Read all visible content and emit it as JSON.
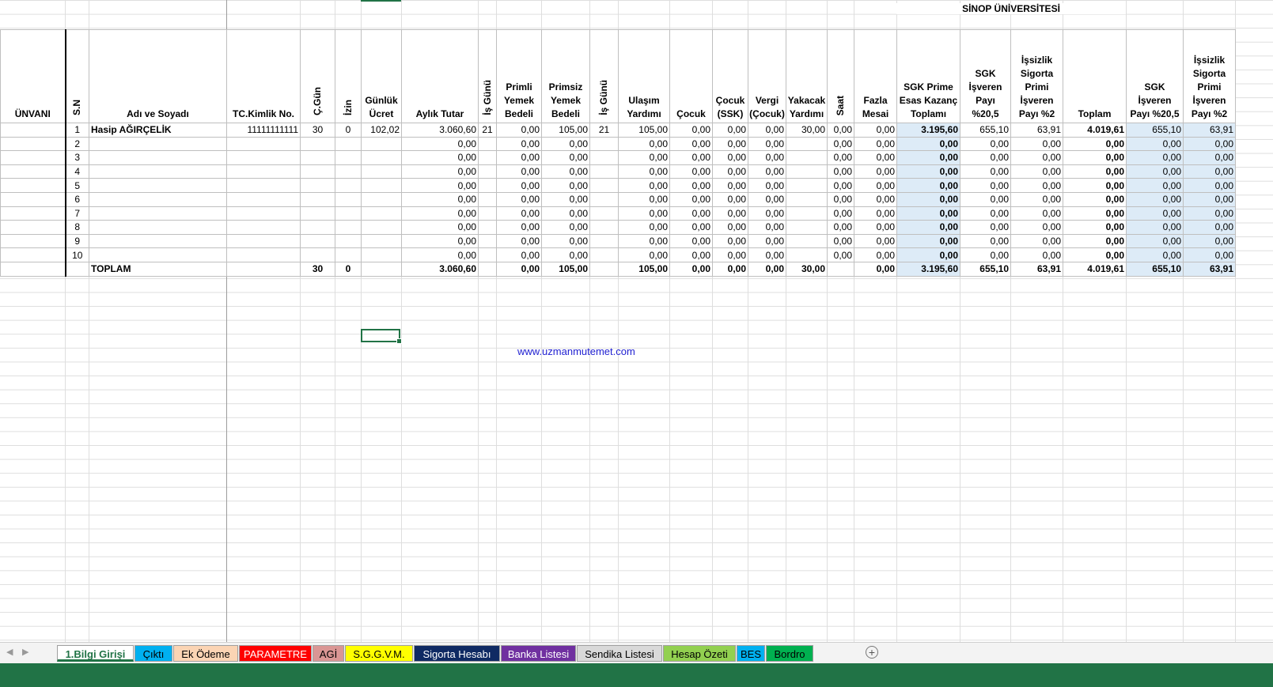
{
  "title": "SİNOP ÜNİVERSİTESİ",
  "headers": [
    "ÜNVANI",
    "S.N",
    "Adı ve Soyadı",
    "TC.Kimlik No.",
    "Ç.Gün",
    "İzin",
    "Günlük Ücret",
    "Aylık Tutar",
    "İş Günü",
    "Primli Yemek Bedeli",
    "Primsiz Yemek Bedeli",
    "İş Günü",
    "Ulaşım Yardımı",
    "Çocuk",
    "Çocuk (SSK)",
    "Vergi (Çocuk)",
    "Yakacak Yardımı",
    "Saat",
    "Fazla Mesai",
    "SGK Prime Esas Kazanç Toplamı",
    "SGK İşveren Payı %20,5",
    "İşsizlik Sigorta Primi İşveren Payı %2",
    "Toplam",
    "SGK İşveren Payı %20,5",
    "İşsizlik Sigorta Primi İşveren Payı %2"
  ],
  "rows": [
    [
      "",
      "1",
      "Hasip AĞIRÇELİK",
      "11111111111",
      "30",
      "0",
      "102,02",
      "3.060,60",
      "21",
      "0,00",
      "105,00",
      "21",
      "105,00",
      "0,00",
      "0,00",
      "0,00",
      "30,00",
      "0,00",
      "0,00",
      "3.195,60",
      "655,10",
      "63,91",
      "4.019,61",
      "655,10",
      "63,91"
    ],
    [
      "",
      "2",
      "",
      "",
      "",
      "",
      "",
      "0,00",
      "",
      "0,00",
      "0,00",
      "",
      "0,00",
      "0,00",
      "0,00",
      "0,00",
      "",
      "0,00",
      "0,00",
      "0,00",
      "0,00",
      "0,00",
      "0,00",
      "0,00",
      "0,00"
    ],
    [
      "",
      "3",
      "",
      "",
      "",
      "",
      "",
      "0,00",
      "",
      "0,00",
      "0,00",
      "",
      "0,00",
      "0,00",
      "0,00",
      "0,00",
      "",
      "0,00",
      "0,00",
      "0,00",
      "0,00",
      "0,00",
      "0,00",
      "0,00",
      "0,00"
    ],
    [
      "",
      "4",
      "",
      "",
      "",
      "",
      "",
      "0,00",
      "",
      "0,00",
      "0,00",
      "",
      "0,00",
      "0,00",
      "0,00",
      "0,00",
      "",
      "0,00",
      "0,00",
      "0,00",
      "0,00",
      "0,00",
      "0,00",
      "0,00",
      "0,00"
    ],
    [
      "",
      "5",
      "",
      "",
      "",
      "",
      "",
      "0,00",
      "",
      "0,00",
      "0,00",
      "",
      "0,00",
      "0,00",
      "0,00",
      "0,00",
      "",
      "0,00",
      "0,00",
      "0,00",
      "0,00",
      "0,00",
      "0,00",
      "0,00",
      "0,00"
    ],
    [
      "",
      "6",
      "",
      "",
      "",
      "",
      "",
      "0,00",
      "",
      "0,00",
      "0,00",
      "",
      "0,00",
      "0,00",
      "0,00",
      "0,00",
      "",
      "0,00",
      "0,00",
      "0,00",
      "0,00",
      "0,00",
      "0,00",
      "0,00",
      "0,00"
    ],
    [
      "",
      "7",
      "",
      "",
      "",
      "",
      "",
      "0,00",
      "",
      "0,00",
      "0,00",
      "",
      "0,00",
      "0,00",
      "0,00",
      "0,00",
      "",
      "0,00",
      "0,00",
      "0,00",
      "0,00",
      "0,00",
      "0,00",
      "0,00",
      "0,00"
    ],
    [
      "",
      "8",
      "",
      "",
      "",
      "",
      "",
      "0,00",
      "",
      "0,00",
      "0,00",
      "",
      "0,00",
      "0,00",
      "0,00",
      "0,00",
      "",
      "0,00",
      "0,00",
      "0,00",
      "0,00",
      "0,00",
      "0,00",
      "0,00",
      "0,00"
    ],
    [
      "",
      "9",
      "",
      "",
      "",
      "",
      "",
      "0,00",
      "",
      "0,00",
      "0,00",
      "",
      "0,00",
      "0,00",
      "0,00",
      "0,00",
      "",
      "0,00",
      "0,00",
      "0,00",
      "0,00",
      "0,00",
      "0,00",
      "0,00",
      "0,00"
    ],
    [
      "",
      "10",
      "",
      "",
      "",
      "",
      "",
      "0,00",
      "",
      "0,00",
      "0,00",
      "",
      "0,00",
      "0,00",
      "0,00",
      "0,00",
      "",
      "0,00",
      "0,00",
      "0,00",
      "0,00",
      "0,00",
      "0,00",
      "0,00",
      "0,00"
    ]
  ],
  "totals": [
    "",
    "",
    "TOPLAM",
    "",
    "30",
    "0",
    "",
    "3.060,60",
    "",
    "0,00",
    "105,00",
    "",
    "105,00",
    "0,00",
    "0,00",
    "0,00",
    "30,00",
    "",
    "0,00",
    "3.195,60",
    "655,10",
    "63,91",
    "4.019,61",
    "655,10",
    "63,91"
  ],
  "link": "www.uzmanmutemet.com",
  "sheet_tabs": [
    {
      "label": "1.Bilgi Girişi",
      "bg": "#ffffff",
      "color": "#217346"
    },
    {
      "label": "Çıktı",
      "bg": "#00b0f0",
      "color": "#000000"
    },
    {
      "label": "Ek Ödeme",
      "bg": "#fbd4b4",
      "color": "#000000"
    },
    {
      "label": "PARAMETRE",
      "bg": "#ff0000",
      "color": "#ffffff"
    },
    {
      "label": "AGİ",
      "bg": "#da9694",
      "color": "#000000"
    },
    {
      "label": "S.G.G.V.M.",
      "bg": "#ffff00",
      "color": "#000000"
    },
    {
      "label": "Sigorta Hesabı",
      "bg": "#0f2a63",
      "color": "#ffffff"
    },
    {
      "label": "Banka Listesi",
      "bg": "#7030a0",
      "color": "#ffffff"
    },
    {
      "label": "Sendika Listesi",
      "bg": "#d9d9d9",
      "color": "#000000"
    },
    {
      "label": "Hesap Özeti",
      "bg": "#92d050",
      "color": "#000000"
    },
    {
      "label": "BES",
      "bg": "#00b0f0",
      "color": "#000000"
    },
    {
      "label": "Bordro",
      "bg": "#00b050",
      "color": "#000000"
    }
  ],
  "icons": {
    "prev": "chevron-left-icon",
    "next": "chevron-right-icon",
    "add": "plus-circle-icon"
  },
  "add_symbol": "+"
}
